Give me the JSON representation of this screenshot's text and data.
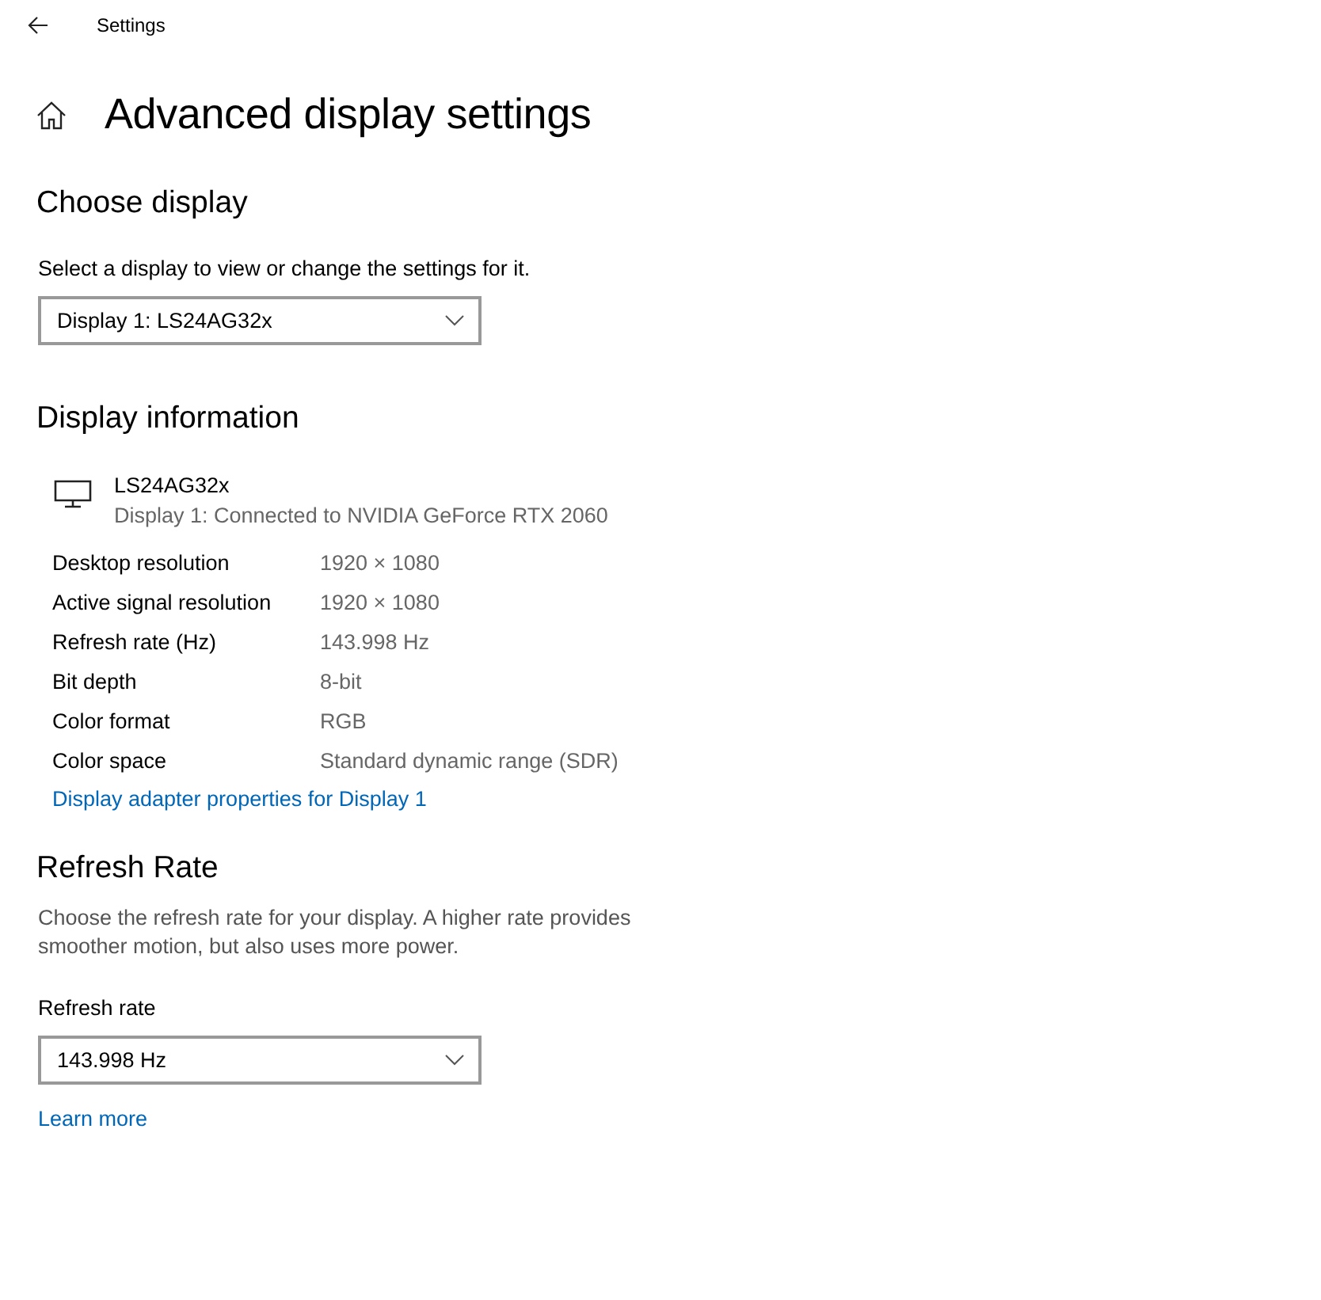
{
  "window": {
    "title": "Settings"
  },
  "page": {
    "title": "Advanced display settings"
  },
  "choose_display": {
    "heading": "Choose display",
    "description": "Select a display to view or change the settings for it.",
    "dropdown": {
      "value": "Display 1: LS24AG32x"
    }
  },
  "display_information": {
    "heading": "Display information",
    "monitor": {
      "name": "LS24AG32x",
      "connection": "Display 1: Connected to NVIDIA GeForce RTX 2060"
    },
    "rows": [
      {
        "label": "Desktop resolution",
        "value": "1920 × 1080"
      },
      {
        "label": "Active signal resolution",
        "value": "1920 × 1080"
      },
      {
        "label": "Refresh rate (Hz)",
        "value": "143.998 Hz"
      },
      {
        "label": "Bit depth",
        "value": "8-bit"
      },
      {
        "label": "Color format",
        "value": "RGB"
      },
      {
        "label": "Color space",
        "value": "Standard dynamic range (SDR)"
      }
    ],
    "link": "Display adapter properties for Display 1"
  },
  "refresh_rate": {
    "heading": "Refresh Rate",
    "description": "Choose the refresh rate for your display. A higher rate provides smoother motion, but also uses more power.",
    "field_label": "Refresh rate",
    "dropdown": {
      "value": "143.998 Hz"
    },
    "link": "Learn more"
  }
}
